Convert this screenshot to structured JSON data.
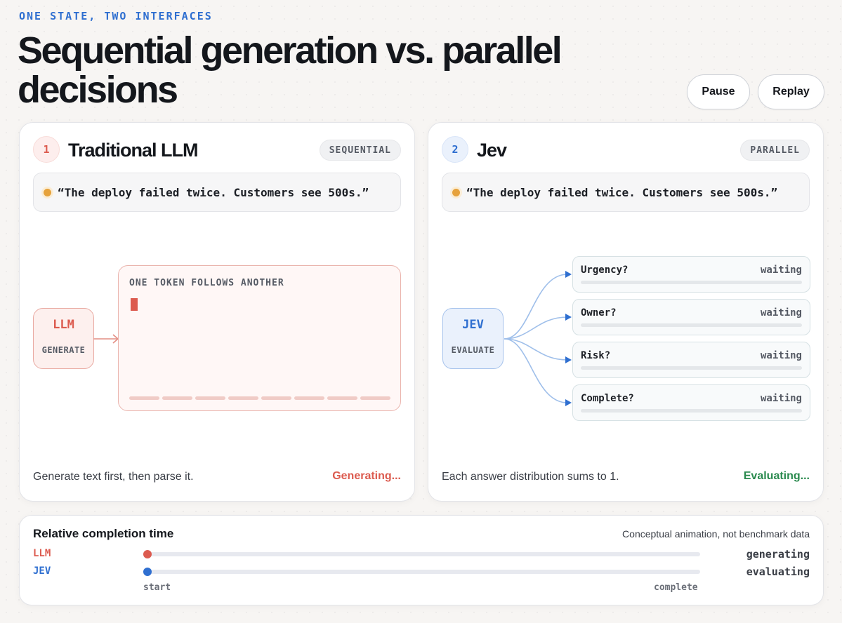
{
  "header": {
    "eyebrow": "ONE STATE, TWO INTERFACES",
    "title": "Sequential generation vs. parallel decisions",
    "pause_label": "Pause",
    "replay_label": "Replay"
  },
  "colors": {
    "llm_accent": "#dc5b4f",
    "jev_accent": "#2f6fd0",
    "evaluating_green": "#2a8a4e",
    "prompt_dot": "#e6a23c"
  },
  "left_panel": {
    "number": "1",
    "title": "Traditional LLM",
    "tag": "SEQUENTIAL",
    "quote": "“The deploy failed twice. Customers see 500s.”",
    "node_name": "LLM",
    "node_sub": "GENERATE",
    "token_box_label": "ONE TOKEN FOLLOWS ANOTHER",
    "description": "Generate text first, then parse it.",
    "status": "Generating..."
  },
  "right_panel": {
    "number": "2",
    "title": "Jev",
    "tag": "PARALLEL",
    "quote": "“The deploy failed twice. Customers see 500s.”",
    "node_name": "JEV",
    "node_sub": "EVALUATE",
    "questions": [
      {
        "label": "Urgency?",
        "state": "waiting"
      },
      {
        "label": "Owner?",
        "state": "waiting"
      },
      {
        "label": "Risk?",
        "state": "waiting"
      },
      {
        "label": "Complete?",
        "state": "waiting"
      }
    ],
    "description": "Each answer distribution sums to 1.",
    "status": "Evaluating..."
  },
  "timeline": {
    "title": "Relative completion time",
    "note": "Conceptual animation, not benchmark data",
    "rows": [
      {
        "label": "LLM",
        "state": "generating",
        "progress": 0.0
      },
      {
        "label": "JEV",
        "state": "evaluating",
        "progress": 0.0
      }
    ],
    "axis_start": "start",
    "axis_end": "complete"
  }
}
